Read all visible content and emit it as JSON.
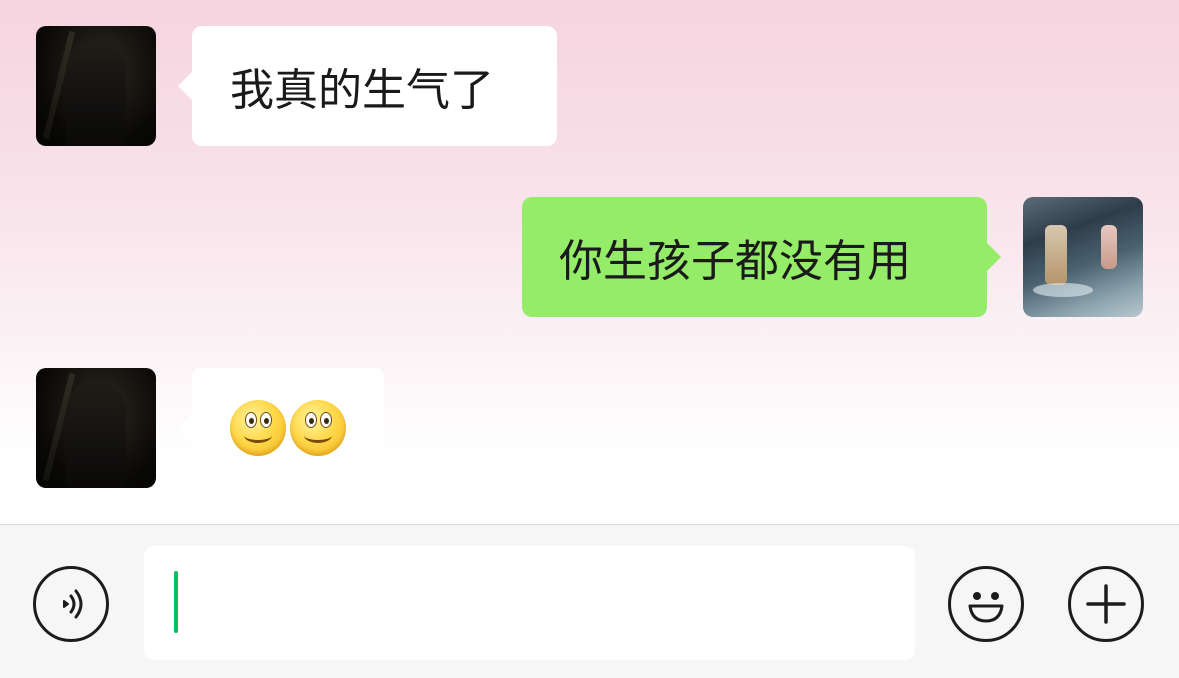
{
  "messages": [
    {
      "sender": "other",
      "type": "text",
      "text": "我真的生气了"
    },
    {
      "sender": "self",
      "type": "text",
      "text": "你生孩子都没有用"
    },
    {
      "sender": "other",
      "type": "emoji",
      "emojis": [
        "smile-emoji",
        "smile-emoji"
      ]
    }
  ],
  "input_bar": {
    "input_value": "",
    "icons": {
      "voice": "voice-icon",
      "emoji": "emoji-icon",
      "add": "plus-icon"
    }
  },
  "colors": {
    "self_bubble": "#95ec69",
    "other_bubble": "#ffffff",
    "caret": "#07c160",
    "icon_stroke": "#1c1c1c"
  }
}
